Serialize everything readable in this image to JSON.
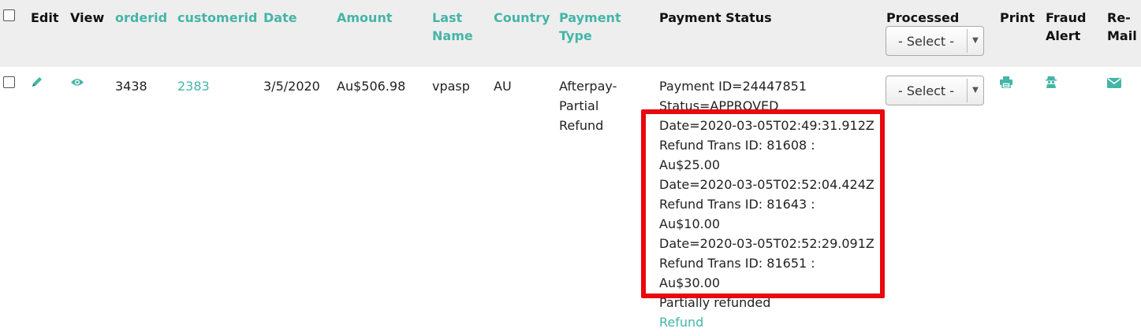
{
  "headers": {
    "edit": "Edit",
    "view": "View",
    "orderid": "orderid",
    "customerid": "customerid",
    "date": "Date",
    "amount": "Amount",
    "last_name": [
      "Last",
      "Name"
    ],
    "country": "Country",
    "payment_type": [
      "Payment",
      "Type"
    ],
    "payment_status": "Payment Status",
    "processed": "Processed",
    "print": "Print",
    "fraud_alert": [
      "Fraud",
      "Alert"
    ],
    "remail": [
      "Re-",
      "Mail"
    ]
  },
  "filters": {
    "processed_select": "- Select -"
  },
  "row": {
    "orderid": "3438",
    "customerid": "2383",
    "date": "3/5/2020",
    "amount": "Au$506.98",
    "last_name": "vpasp",
    "country": "AU",
    "payment_type": [
      "Afterpay-",
      "Partial",
      "Refund"
    ],
    "payment_status_lines": [
      "Payment ID=24447851",
      "Status=APPROVED",
      "Date=2020-03-05T02:49:31.912Z",
      "Refund Trans ID: 81608 :",
      "Au$25.00",
      "Date=2020-03-05T02:52:04.424Z",
      "Refund Trans ID: 81643 :",
      "Au$10.00",
      "Date=2020-03-05T02:52:29.091Z",
      "Refund Trans ID: 81651 :",
      "Au$30.00",
      "Partially refunded"
    ],
    "refund_link": "Refund",
    "processed_select": "- Select -"
  },
  "icons": {
    "edit": "pencil-icon",
    "view": "eye-icon",
    "print": "printer-icon",
    "fraud": "spy-icon",
    "remail": "envelope-icon"
  },
  "colors": {
    "accent": "#45b5a7",
    "header_bg": "#eeeeee",
    "highlight": "#e8080e"
  }
}
